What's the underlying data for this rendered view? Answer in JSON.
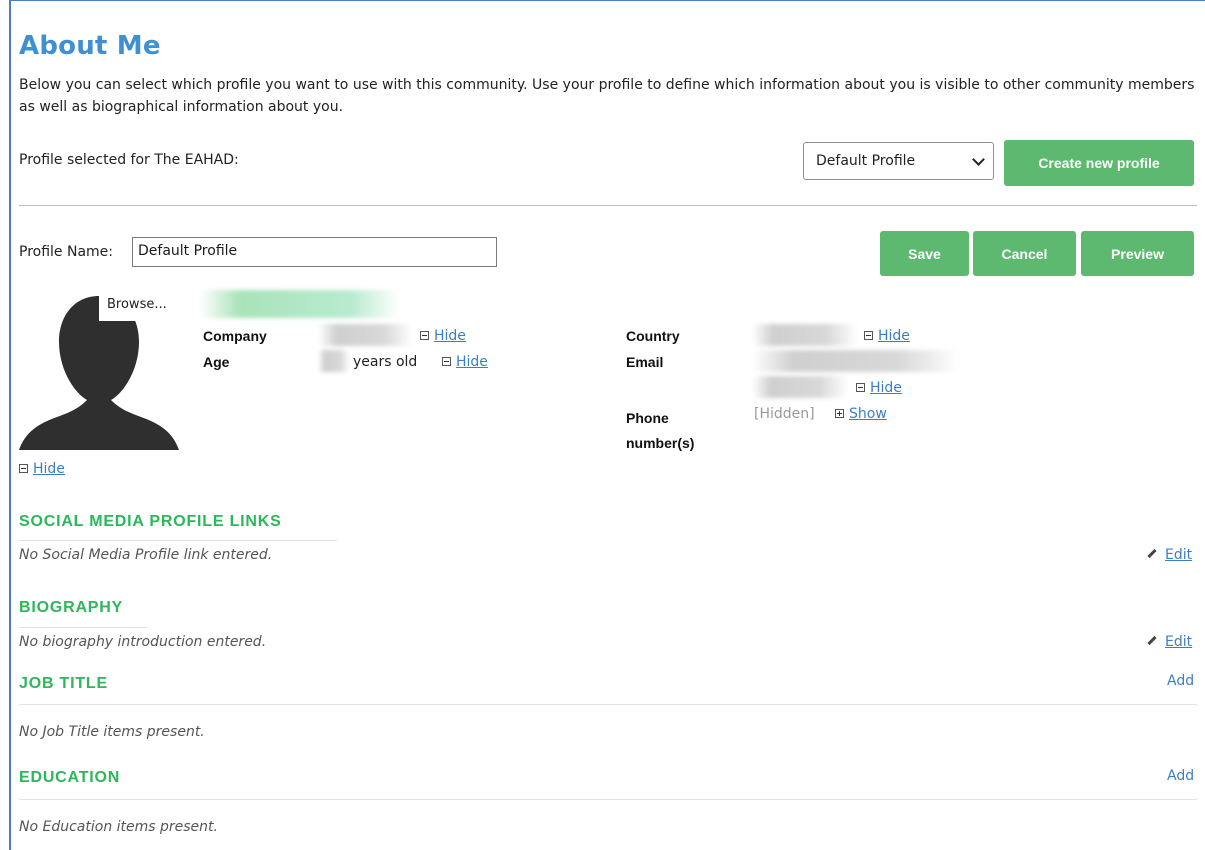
{
  "page": {
    "title": "About Me",
    "intro": "Below you can select which profile you want to use with this community. Use your profile to define which information about you is visible to other community members as well as biographical information about you."
  },
  "profile_select": {
    "label": "Profile selected for The EAHAD:",
    "selected": "Default Profile",
    "create_button": "Create new profile"
  },
  "profile": {
    "name_label": "Profile Name:",
    "name_value": "Default Profile",
    "buttons": {
      "save": "Save",
      "cancel": "Cancel",
      "preview": "Preview"
    },
    "photo": {
      "browse_label": "Browse...",
      "toggle": "Hide"
    },
    "fields": {
      "company": {
        "label": "Company",
        "toggle": "Hide"
      },
      "age": {
        "label": "Age",
        "suffix": "years old",
        "toggle": "Hide"
      },
      "country": {
        "label": "Country",
        "toggle": "Hide"
      },
      "email": {
        "label": "Email",
        "toggle": "Hide"
      },
      "phone": {
        "label": "Phone number(s)",
        "value": "[Hidden]",
        "toggle": "Show"
      }
    }
  },
  "sections": {
    "social": {
      "title": "SOCIAL MEDIA PROFILE LINKS",
      "empty": "No Social Media Profile link entered.",
      "action": "Edit"
    },
    "biography": {
      "title": "BIOGRAPHY",
      "empty": "No biography introduction entered.",
      "action": "Edit"
    },
    "job_title": {
      "title": "JOB TITLE",
      "empty": "No Job Title items present.",
      "action": "Add"
    },
    "education": {
      "title": "EDUCATION",
      "empty": "No Education items present.",
      "action": "Add"
    }
  },
  "colors": {
    "accent_blue": "#3f8fd3",
    "button_green": "#5cb96f",
    "section_green": "#2db65a",
    "link_blue": "#3a7fc6"
  },
  "icons": {
    "edit": "pencil-icon",
    "collapse": "minus-box-icon",
    "expand": "plus-box-icon",
    "select": "chevron-down-icon"
  }
}
